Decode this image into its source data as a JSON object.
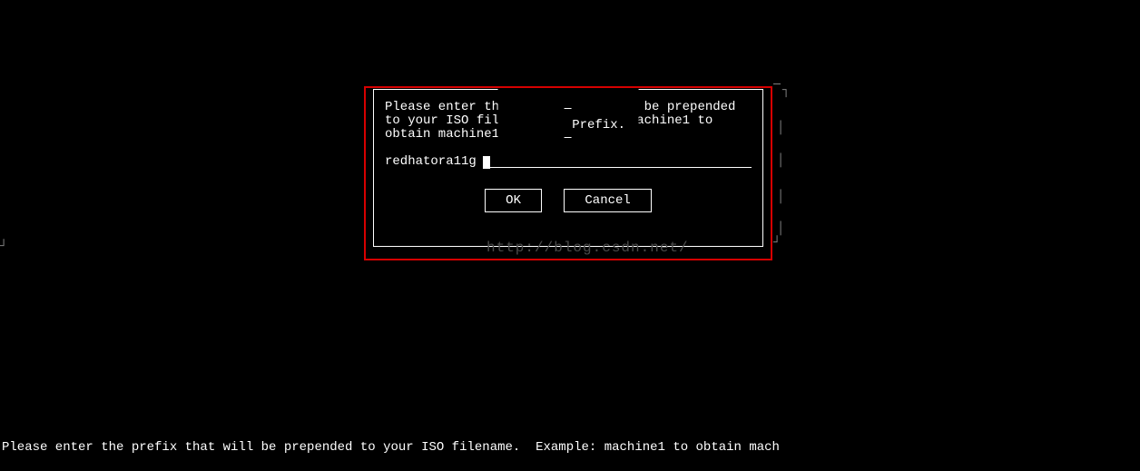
{
  "dialog": {
    "title": "Prefix.",
    "prompt": "Please enter the prefix that will be prepended to your ISO filename.  Example: machine1 to obtain machine1-[1-9]*.iso files",
    "input_value": "redhatora11g",
    "ok_label": "OK",
    "cancel_label": "Cancel"
  },
  "status_line": "Please enter the prefix that will be prepended to your ISO filename.  Example: machine1 to obtain mach",
  "watermark": "http://blog.csdn.net/",
  "bg_fragments": {
    "right_top_corner": "┐",
    "right_side": "│",
    "right_bottom_corner": "┘",
    "left_mid": "┘"
  }
}
